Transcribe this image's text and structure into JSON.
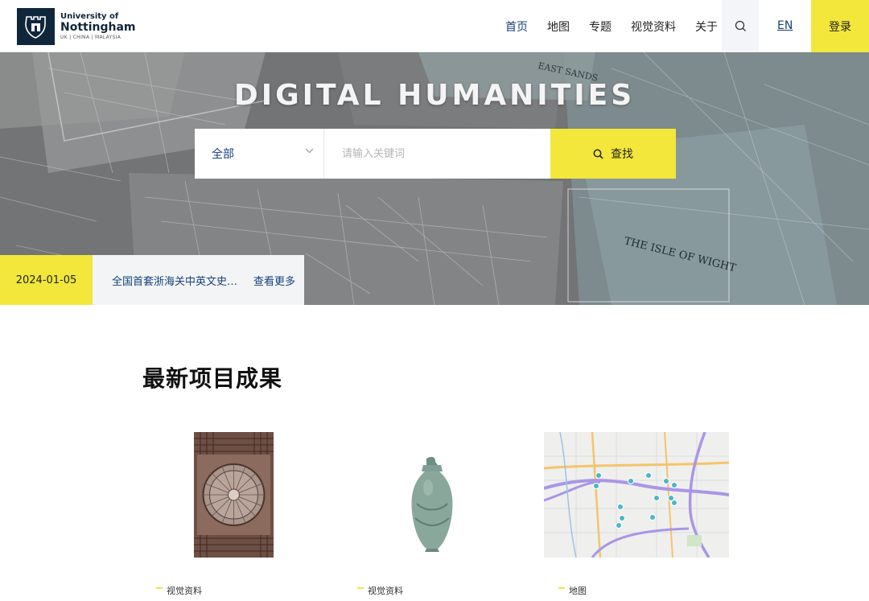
{
  "logo": {
    "line1": "University of",
    "line2": "Nottingham",
    "line3": "UK | CHINA | MALAYSIA"
  },
  "nav": {
    "items": [
      "首页",
      "地图",
      "专题",
      "视觉资料",
      "关于"
    ],
    "active_index": 0,
    "search_icon": "search-icon",
    "lang": "EN",
    "login": "登录"
  },
  "hero": {
    "title": "DIGITAL HUMANITIES",
    "search": {
      "scope_value": "全部",
      "placeholder": "请输入关键词",
      "button": "查找"
    },
    "news": {
      "date": "2024-01-05",
      "title": "全国首套浙海关中英文史料整理出版",
      "more": "查看更多"
    }
  },
  "section": {
    "title": "最新项目成果",
    "cards": [
      {
        "tag": "视觉资料",
        "image": "carved-ceiling-photo"
      },
      {
        "tag": "视觉资料",
        "image": "celadon-vase-photo"
      },
      {
        "tag": "地图",
        "image": "city-map-thumbnail"
      }
    ]
  },
  "colors": {
    "accent": "#f2e73a",
    "brand": "#10263b",
    "link": "#16407a"
  }
}
